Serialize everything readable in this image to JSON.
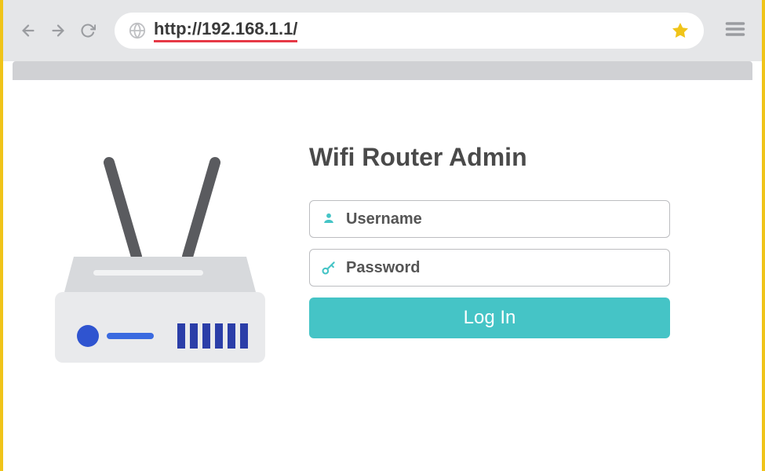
{
  "browser": {
    "url": "http://192.168.1.1/"
  },
  "login": {
    "title": "Wifi Router Admin",
    "username_placeholder": "Username",
    "password_placeholder": "Password",
    "button_label": "Log In"
  }
}
